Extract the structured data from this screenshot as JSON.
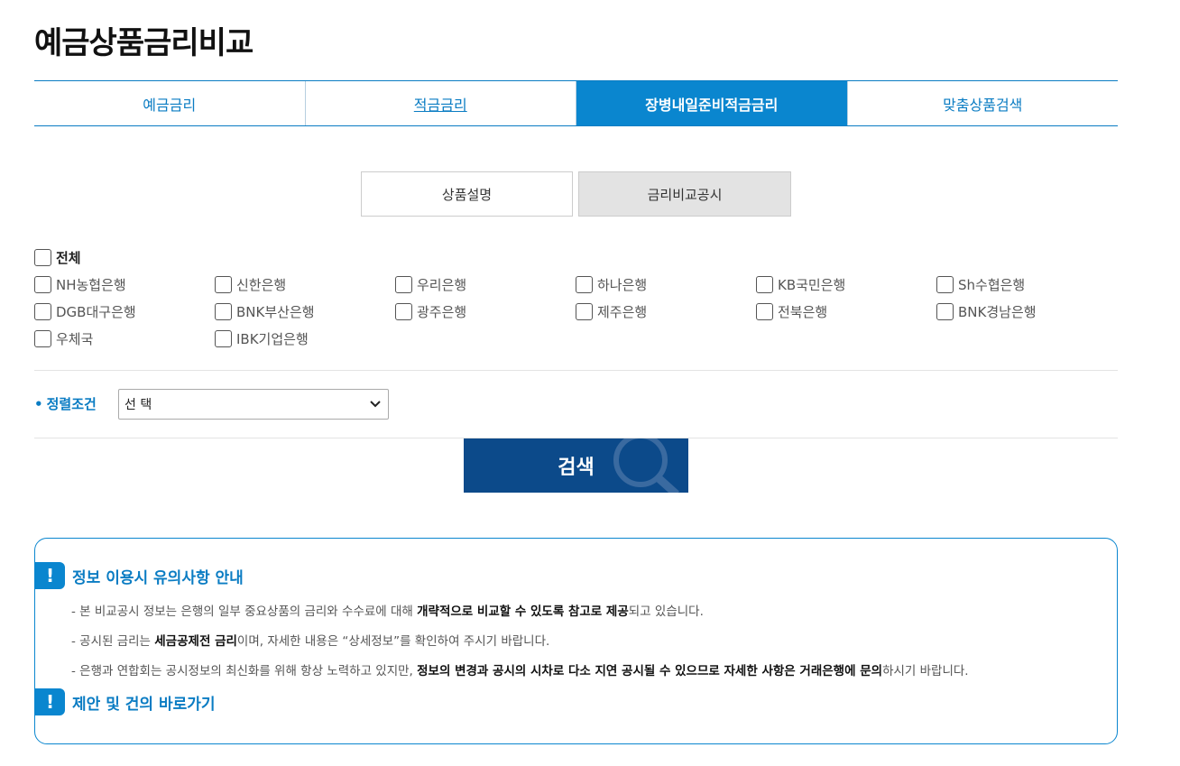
{
  "page_title": "예금상품금리비교",
  "main_tabs": [
    {
      "label": "예금금리"
    },
    {
      "label": "적금금리"
    },
    {
      "label": "장병내일준비적금금리"
    },
    {
      "label": "맞춤상품검색"
    }
  ],
  "sub_tabs": [
    {
      "label": "상품설명"
    },
    {
      "label": "금리비교공시"
    }
  ],
  "banks": {
    "all_label": "전체",
    "row1": [
      "NH농협은행",
      "신한은행",
      "우리은행",
      "하나은행",
      "KB국민은행",
      "Sh수협은행"
    ],
    "row2": [
      "DGB대구은행",
      "BNK부산은행",
      "광주은행",
      "제주은행",
      "전북은행",
      "BNK경남은행"
    ],
    "row3": [
      "우체국",
      "IBK기업은행"
    ]
  },
  "sort": {
    "label": "정렬조건",
    "dot": "•",
    "selected": "선 택"
  },
  "search_button": {
    "label": "검색"
  },
  "notice": {
    "title": "정보 이용시 유의사항 안내",
    "lines": [
      {
        "pre": "- 본 비교공시 정보는 은행의 일부 중요상품의 금리와 수수료에 대해 ",
        "bold": "개략적으로 비교할 수 있도록 참고로 제공",
        "post": "되고 있습니다."
      },
      {
        "pre": "- 공시된 금리는 ",
        "bold": "세금공제전 금리",
        "post": "이며, 자세한 내용은 “상세정보”를 확인하여 주시기 바랍니다."
      },
      {
        "pre": "- 은행과 연합회는 공시정보의 최신화를 위해 항상 노력하고 있지만, ",
        "bold": "정보의 변경과 공시의 시차로 다소 지연 공시될 수 있으므로 자세한 사항은 거래은행에 문의",
        "post": "하시기 바랍니다."
      }
    ],
    "link_title": "제안 및 건의 바로가기",
    "icon_mark": "!"
  },
  "colors": {
    "accent": "#0a86cf",
    "search_button": "#0c4a8a"
  }
}
